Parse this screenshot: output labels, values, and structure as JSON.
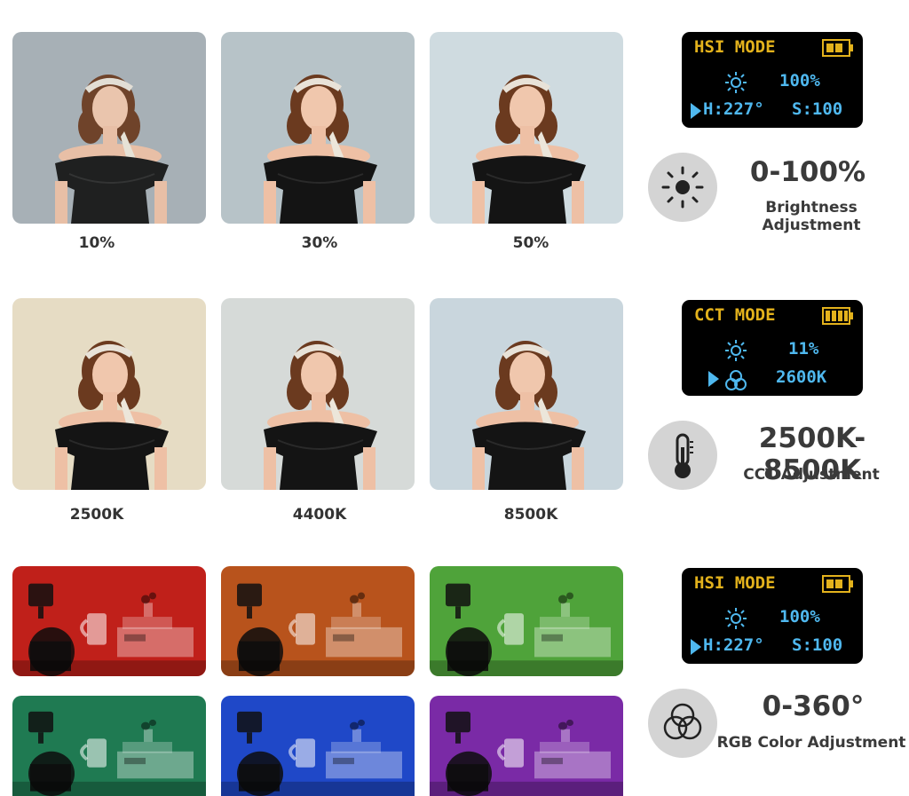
{
  "brightness_section": {
    "captions": [
      "10%",
      "30%",
      "50%"
    ],
    "lcd": {
      "mode": "HSI MODE",
      "brightness": "100%",
      "hue": "H:227°",
      "saturation": "S:100"
    },
    "range": "0-100%",
    "label": "Brightness Adjustment"
  },
  "cct_section": {
    "captions": [
      "2500K",
      "4400K",
      "8500K"
    ],
    "lcd": {
      "mode": "CCT MODE",
      "brightness": "11%",
      "temperature": "2600K"
    },
    "range": "2500K-8500K",
    "label": "CCT Adjustment"
  },
  "rgb_section": {
    "lcd": {
      "mode": "HSI MODE",
      "brightness": "100%",
      "hue": "H:227°",
      "saturation": "S:100"
    },
    "range": "0-360°",
    "label": "RGB Color Adjustment",
    "tile_colors": [
      "#c0201a",
      "#b8531c",
      "#4fa33a",
      "#1f7a52",
      "#1f48c8",
      "#7a2aa6"
    ]
  },
  "colors": {
    "lcd_yellow": "#e3b21c",
    "lcd_blue": "#4fb8ef",
    "badge_gray": "#d4d4d4"
  }
}
